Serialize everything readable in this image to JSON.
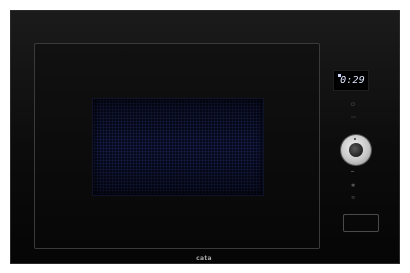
{
  "display": {
    "time": "0:29"
  },
  "brand": {
    "name": "cata",
    "tagline": ""
  },
  "controls": {
    "knob": "rotary-selector-knob",
    "stop_button": "stop-button"
  },
  "icons": [
    "power-icon",
    "grill-icon",
    "microwave-icon",
    "defrost-icon",
    "convection-icon"
  ],
  "colors": {
    "body": "#0c0c0c",
    "display_text": "#dfe6ff",
    "knob": "#c8c8c8"
  }
}
